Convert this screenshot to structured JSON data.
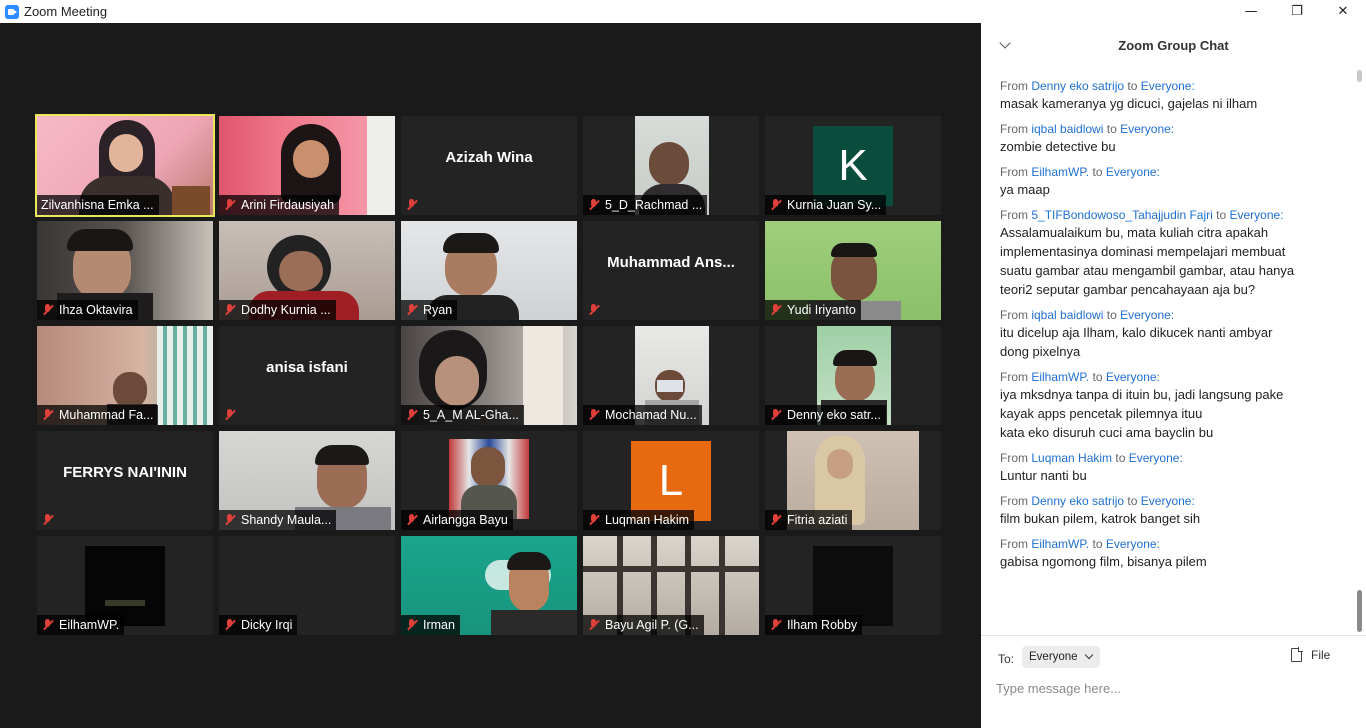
{
  "window": {
    "title": "Zoom Meeting"
  },
  "participants": [
    {
      "name": "Zilvanhisna Emka ...",
      "muted": false
    },
    {
      "name": "Arini Firdausiyah",
      "muted": true
    },
    {
      "name": "",
      "display_name": "Azizah Wina",
      "muted": true
    },
    {
      "name": "5_D_Rachmad ...",
      "muted": true
    },
    {
      "name": "Kurnia Juan Sy...",
      "muted": true,
      "avatar_letter": "K"
    },
    {
      "name": "Ihza Oktavira",
      "muted": true
    },
    {
      "name": "Dodhy Kurnia ...",
      "muted": true
    },
    {
      "name": "Ryan",
      "muted": true
    },
    {
      "name": "",
      "display_name": "Muhammad  Ans...",
      "muted": true
    },
    {
      "name": "Yudi Iriyanto",
      "muted": true
    },
    {
      "name": "Muhammad Fa...",
      "muted": true
    },
    {
      "name": "",
      "display_name": "anisa isfani",
      "muted": true
    },
    {
      "name": "5_A_M AL-Gha...",
      "muted": true
    },
    {
      "name": "Mochamad Nu...",
      "muted": true
    },
    {
      "name": "Denny eko satr...",
      "muted": true
    },
    {
      "name": "",
      "display_name": "FERRYS NAI'ININ",
      "muted": true
    },
    {
      "name": "Shandy Maula...",
      "muted": true
    },
    {
      "name": "Airlangga Bayu",
      "muted": true
    },
    {
      "name": "Luqman Hakim",
      "muted": true,
      "avatar_letter": "L"
    },
    {
      "name": "Fitria aziati",
      "muted": true
    },
    {
      "name": "EilhamWP.",
      "muted": true
    },
    {
      "name": "Dicky Irqi",
      "muted": true
    },
    {
      "name": "Irman",
      "muted": true
    },
    {
      "name": "Bayu Agil P. (G...",
      "muted": true
    },
    {
      "name": "Ilham Robby",
      "muted": true
    }
  ],
  "chat": {
    "title": "Zoom Group Chat",
    "from_label": "From",
    "to_label": "to",
    "messages": [
      {
        "sender": "Denny eko satrijo",
        "recipient": "Everyone:",
        "lines": [
          "masak kameranya yg dicuci, gajelas ni ilham"
        ]
      },
      {
        "sender": "iqbal baidlowi",
        "recipient": "Everyone:",
        "lines": [
          "zombie detective bu"
        ]
      },
      {
        "sender": "EilhamWP.",
        "recipient": "Everyone:",
        "lines": [
          "ya maap"
        ]
      },
      {
        "sender": "5_TIFBondowoso_Tahajjudin Fajri",
        "recipient": "Everyone:",
        "lines": [
          "Assalamualaikum bu, mata kuliah citra apakah",
          "implementasinya dominasi mempelajari membuat",
          "suatu gambar atau mengambil gambar, atau hanya",
          "teori2 seputar gambar pencahayaan aja bu?"
        ]
      },
      {
        "sender": "iqbal baidlowi",
        "recipient": "Everyone:",
        "lines": [
          "itu dicelup aja Ilham, kalo dikucek nanti ambyar",
          "dong pixelnya"
        ]
      },
      {
        "sender": "EilhamWP.",
        "recipient": "Everyone:",
        "lines": [
          "iya mksdnya tanpa di ituin bu, jadi langsung pake",
          "kayak apps pencetak pilemnya ituu",
          "kata eko disuruh cuci ama bayclin bu"
        ]
      },
      {
        "sender": "Luqman Hakim",
        "recipient": "Everyone:",
        "lines": [
          "Luntur nanti bu"
        ]
      },
      {
        "sender": "Denny eko satrijo",
        "recipient": "Everyone:",
        "lines": [
          "film bukan pilem, katrok banget sih"
        ]
      },
      {
        "sender": "EilhamWP.",
        "recipient": "Everyone:",
        "lines": [
          "gabisa ngomong film, bisanya pilem"
        ]
      }
    ],
    "to_prefix": "To:",
    "recipient_select": "Everyone",
    "file_label": "File",
    "input_placeholder": "Type message here..."
  },
  "colors": {
    "sender_link": "#1f6fd1",
    "active_speaker_border": "#e8e85a",
    "muted_mic": "#e0403a"
  }
}
